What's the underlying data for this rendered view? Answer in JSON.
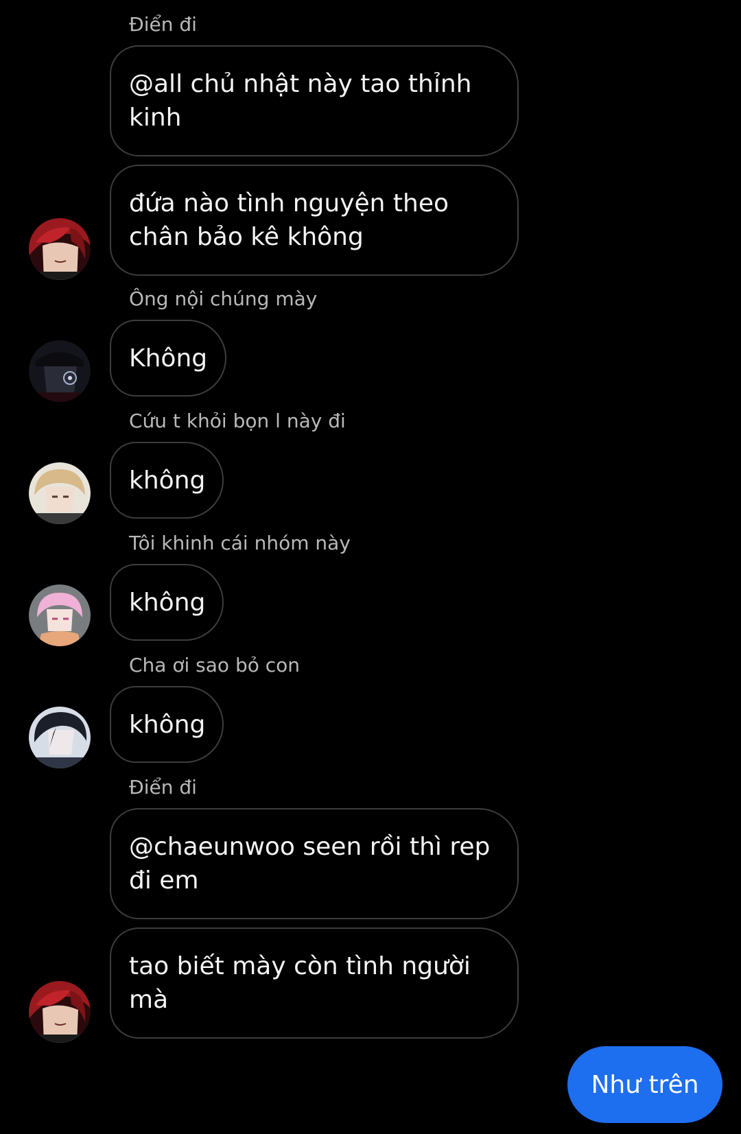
{
  "messages": {
    "m1": {
      "sender": "Điển đi",
      "bubble1": "@all chủ nhật này tao thỉnh kinh",
      "bubble2": "đứa nào tình nguyện theo chân bảo kê không"
    },
    "m2": {
      "sender": "Ông nội chúng mày",
      "text": "Không"
    },
    "m3": {
      "sender": "Cứu t khỏi bọn l này đi",
      "text": "không"
    },
    "m4": {
      "sender": "Tôi khinh cái nhóm này",
      "text": "không"
    },
    "m5": {
      "sender": "Cha ơi sao bỏ con",
      "text": "không"
    },
    "m6": {
      "sender": "Điển đi",
      "bubble1": "@chaeunwoo seen rồi thì rep đi em",
      "bubble2": "tao biết mày còn tình người mà"
    }
  },
  "sent": {
    "text": "Như trên"
  },
  "colors": {
    "background": "#000000",
    "bubble_border": "#3d3d3d",
    "sent_bubble": "#1e6ef0",
    "sender_name": "#b9b9b9"
  },
  "icons": {
    "avatar1": "red-hair-avatar-icon",
    "avatar2": "dark-hat-avatar-icon",
    "avatar3": "blonde-avatar-icon",
    "avatar4": "pink-hair-avatar-icon",
    "avatar5": "black-hair-avatar-icon"
  }
}
